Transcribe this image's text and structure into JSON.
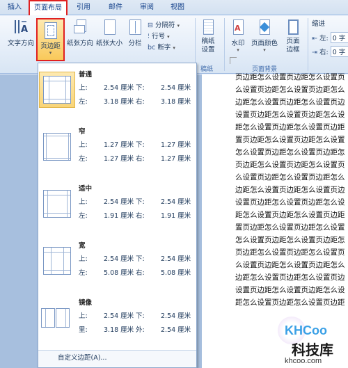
{
  "tabs": [
    {
      "label": "插入",
      "active": false
    },
    {
      "label": "页面布局",
      "active": true
    },
    {
      "label": "引用",
      "active": false
    },
    {
      "label": "邮件",
      "active": false
    },
    {
      "label": "审阅",
      "active": false
    },
    {
      "label": "视图",
      "active": false
    }
  ],
  "ribbon": {
    "text_direction": "文字方向",
    "margins": "页边距",
    "orientation": "纸张方向",
    "size": "纸张大小",
    "columns": "分栏",
    "breaks": "分隔符",
    "line_numbers": "行号",
    "hyphenation": "断字",
    "draft_paper": "稿纸设置",
    "draft_group": "稿纸",
    "watermark": "水印",
    "page_color": "页面颜色",
    "page_borders": "页面边框",
    "page_bg_group": "页面背景",
    "indent_group": "缩进",
    "indent_left_label": "左:",
    "indent_right_label": "右:",
    "indent_left_value": "0 字",
    "indent_right_value": "0 字"
  },
  "margins_menu": {
    "options": [
      {
        "name": "普通",
        "top_label": "上:",
        "top": "2.54 厘米",
        "bottom_label": "下:",
        "bottom": "2.54 厘米",
        "left_label": "左:",
        "left": "3.18 厘米",
        "right_label": "右:",
        "right": "3.18 厘米"
      },
      {
        "name": "窄",
        "top_label": "上:",
        "top": "1.27 厘米",
        "bottom_label": "下:",
        "bottom": "1.27 厘米",
        "left_label": "左:",
        "left": "1.27 厘米",
        "right_label": "右:",
        "right": "1.27 厘米"
      },
      {
        "name": "适中",
        "top_label": "上:",
        "top": "2.54 厘米",
        "bottom_label": "下:",
        "bottom": "2.54 厘米",
        "left_label": "左:",
        "left": "1.91 厘米",
        "right_label": "右:",
        "right": "1.91 厘米"
      },
      {
        "name": "宽",
        "top_label": "上:",
        "top": "2.54 厘米",
        "bottom_label": "下:",
        "bottom": "2.54 厘米",
        "left_label": "左:",
        "left": "5.08 厘米",
        "right_label": "右:",
        "right": "5.08 厘米"
      },
      {
        "name": "镜像",
        "top_label": "上:",
        "top": "2.54 厘米",
        "bottom_label": "下:",
        "bottom": "2.54 厘米",
        "left_label": "里:",
        "left": "3.18 厘米",
        "right_label": "外:",
        "right": "2.54 厘米"
      }
    ],
    "custom": "自定义边距(A)..."
  },
  "document": {
    "lines": [
      "页边距怎么设置页边距怎么设置页",
      "么设置页边距怎么设置页边距怎么",
      "边距怎么设置页边距怎么设置页边",
      "设置页边距怎么设置页边距怎么设",
      "距怎么设置页边距怎么设置页边距",
      "置页边距怎么设置页边距怎么设置",
      "怎么设置页边距怎么设置页边距怎",
      "页边距怎么设置页边距怎么设置页",
      "么设置页边距怎么设置页边距怎么",
      "边距怎么设置页边距怎么设置页边",
      "设置页边距怎么设置页边距怎么设",
      "距怎么设置页边距怎么设置页边距",
      "置页边距怎么设置页边距怎么设置",
      "怎么设置页边距怎么设置页边距怎",
      "页边距怎么设置页边距怎么设置页",
      "么设置页边距怎么设置页边距怎么",
      "边距怎么设置页边距怎么设置页边",
      "设置页边距怎么设置页边距怎么设",
      "距怎么设置页边距怎么设置页边距"
    ]
  },
  "watermark": {
    "logo": "KHCoo",
    "name": "科技库",
    "url": "khcoo.com"
  }
}
